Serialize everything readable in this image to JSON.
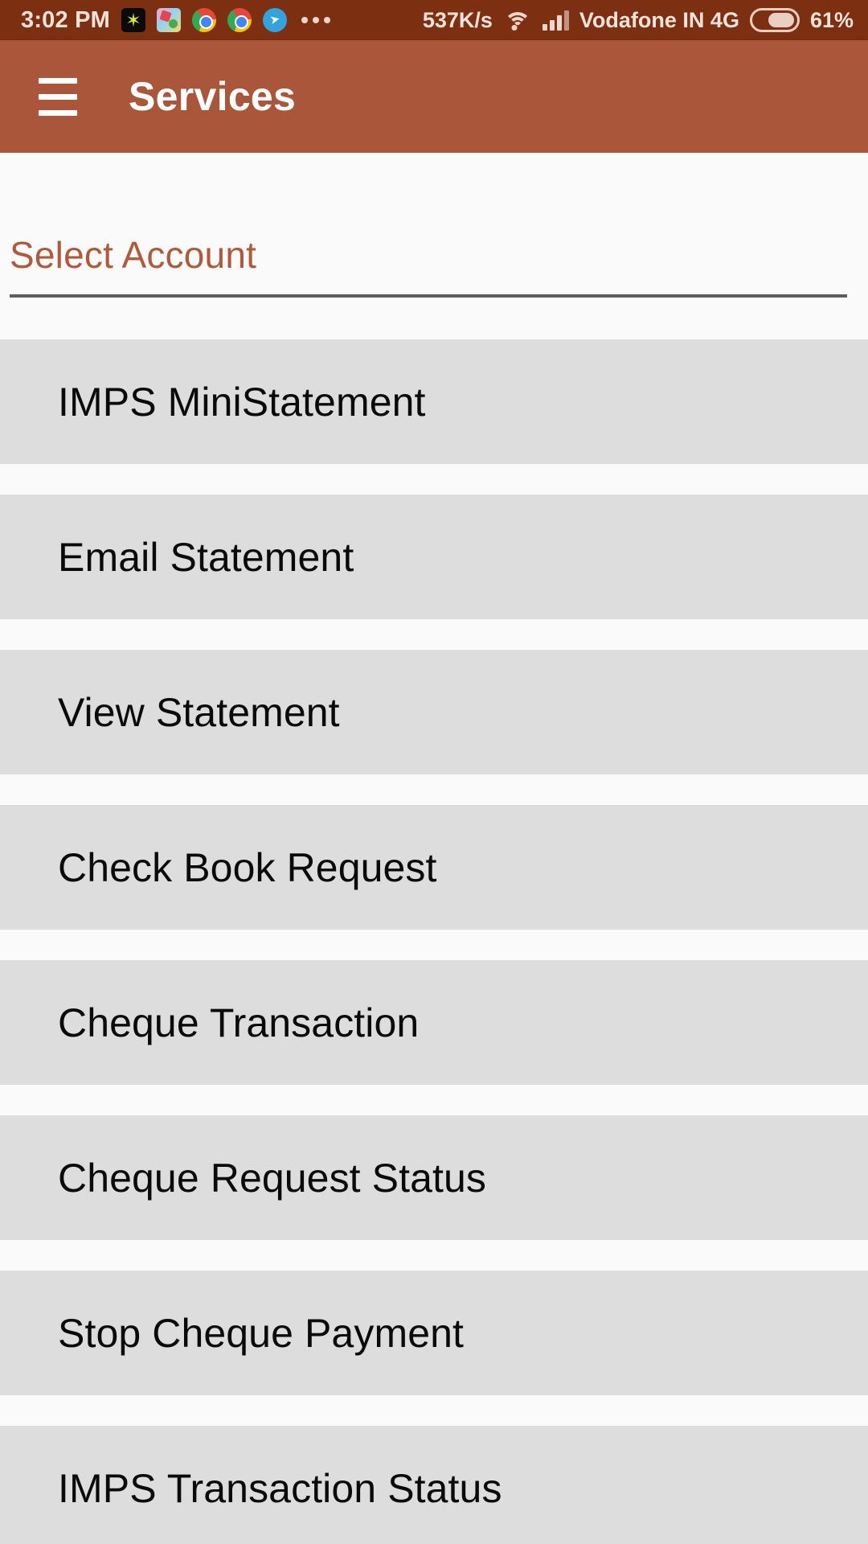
{
  "status_bar": {
    "clock": "3:02 PM",
    "tray_icons": [
      "star-app-icon",
      "candy-game-icon",
      "chrome-icon",
      "chrome-icon",
      "telegram-icon"
    ],
    "overflow_icon": "more-dots-icon",
    "network_speed": "537K/s",
    "wifi_icon": "wifi-icon",
    "signal_icon": "cell-signal-icon",
    "carrier": "Vodafone IN 4G",
    "battery_icon": "battery-icon",
    "battery_percent": "61%"
  },
  "app_bar": {
    "menu_icon": "hamburger-menu-icon",
    "title": "Services",
    "background_color": "#A9563A"
  },
  "account_spinner": {
    "label": "Select Account",
    "accent_color": "#B05A3C",
    "underline_color": "#5E5E5E"
  },
  "services": {
    "item_background": "#DDDDDD",
    "items": [
      {
        "label": "IMPS MiniStatement"
      },
      {
        "label": "Email Statement"
      },
      {
        "label": "View Statement"
      },
      {
        "label": "Check Book Request"
      },
      {
        "label": "Cheque Transaction"
      },
      {
        "label": "Cheque Request Status"
      },
      {
        "label": "Stop Cheque Payment"
      },
      {
        "label": "IMPS Transaction Status"
      }
    ]
  }
}
